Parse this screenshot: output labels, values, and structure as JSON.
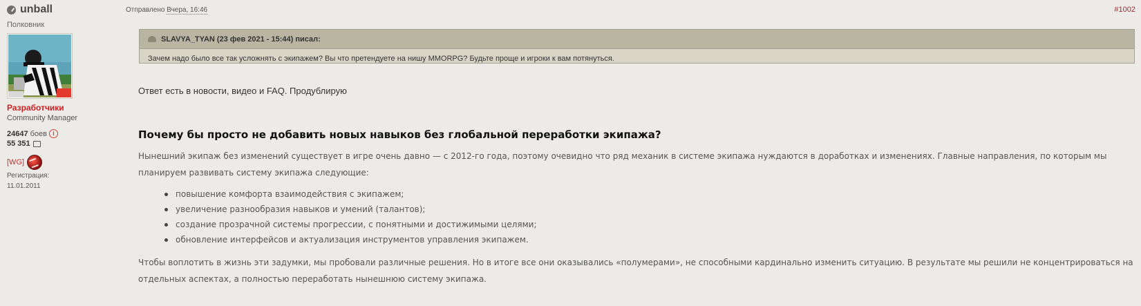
{
  "author": {
    "name": "unball",
    "rank": "Полковник",
    "group": "Разработчики",
    "role": "Community Manager",
    "battles_value": "24647",
    "battles_label": "боев",
    "comments_value": "55 351",
    "clan_tag": "[WG]",
    "registration_label": "Регистрация:",
    "registration_date": "11.01.2011"
  },
  "post": {
    "sent_label": "Отправлено",
    "sent_date": "Вчера, 16:46",
    "number": "#1002"
  },
  "quote": {
    "header": "SLAVYA_TYAN (23 фев 2021 - 15:44) писал:",
    "text": "Зачем надо было все так усложнять с экипажем? Вы что претендуете на нишу MMORPG? Будьте проще и игроки к вам потянуться."
  },
  "content": {
    "intro": "Ответ есть в новости, видео и FAQ. Продублирую",
    "heading": "Почему бы просто не добавить новых навыков без глобальной переработки экипажа?",
    "paragraph1": "Нынешний экипаж без изменений существует в игре очень давно — с 2012-го года, поэтому очевидно что ряд механик в системе экипажа нуждаются в доработках и изменениях. Главные направления, по которым мы планируем развивать систему экипажа следующие:",
    "bullets": [
      "повышение комфорта взаимодействия с экипажем;",
      "увеличение разнообразия навыков и умений (талантов);",
      "создание прозрачной системы прогрессии, с понятными и достижимыми целями;",
      "обновление интерфейсов и актуализация инструментов управления экипажем."
    ],
    "paragraph2": "Чтобы воплотить в жизнь эти задумки, мы пробовали различные решения. Но в итоге все они оказывались «полумерами», не способными кардинально изменить ситуацию. В результате мы решили не концентрироваться на отдельных аспектах, а полностью переработать нынешнюю систему экипажа."
  },
  "colors": {
    "background": "#ecebe8",
    "group": "#cc1f1f",
    "post_number": "#9c2b2b",
    "quote_header": "#b9b5a3",
    "quote_body": "#d8d5c7"
  }
}
